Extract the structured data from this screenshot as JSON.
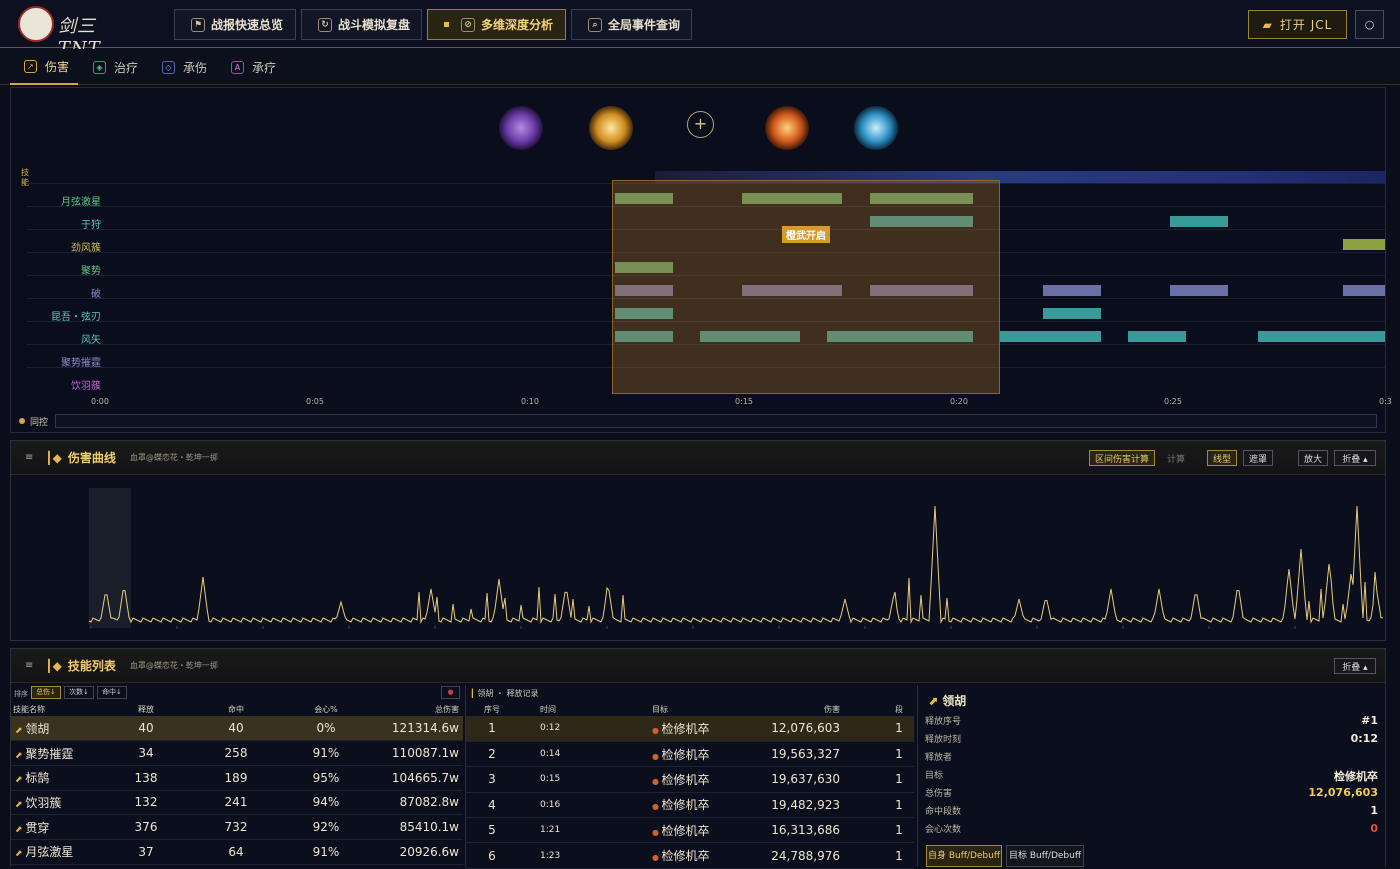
{
  "header": {
    "logo_text": "剑三TNT",
    "nav": [
      {
        "label": "战报快速总览",
        "icon": "flag-icon"
      },
      {
        "label": "战斗模拟复盘",
        "icon": "replay-icon"
      },
      {
        "label": "多维深度分析",
        "icon": "compass-icon",
        "active": true
      },
      {
        "label": "全局事件查询",
        "icon": "search-icon"
      }
    ],
    "open_jcl": "打开 JCL"
  },
  "tabs": [
    {
      "label": "伤害",
      "icon": "damage-icon",
      "active": true
    },
    {
      "label": "治疗",
      "icon": "heal-icon"
    },
    {
      "label": "承伤",
      "icon": "shield-icon"
    },
    {
      "label": "承疗",
      "icon": "receive-heal-icon"
    }
  ],
  "timeline": {
    "side_label": "技能",
    "skills": [
      "月弦激星",
      "于狩",
      "劲风簇",
      "聚势",
      "破",
      "昆吾・弦刃",
      "风矢",
      "聚势摧霆",
      "饮羽簇"
    ],
    "skill_colors": [
      "#5dcb87",
      "#59cfc2",
      "#d0c15a",
      "#5dcb87",
      "#8a8bd0",
      "#59cfc2",
      "#59cfc2",
      "#8a8bd0",
      "#c26ad8"
    ],
    "burst_label": "橙武开启",
    "x_ticks": [
      "0:00",
      "0:05",
      "0:10",
      "0:15",
      "0:20",
      "0:25",
      "0:3"
    ],
    "scrub_label": "同控"
  },
  "damage_curve": {
    "title": "伤害曲线",
    "subtitle": "血罩@蝶恋花・乾坤一掷",
    "buttons": [
      "区间伤害计算",
      "计算",
      "线型",
      "遮罩",
      "放大",
      "折叠 ▴"
    ]
  },
  "skill_list": {
    "title": "技能列表",
    "subtitle": "血罩@蝶恋花・乾坤一掷",
    "fold": "折叠 ▴",
    "sort_label": "排序",
    "sort_buttons": [
      "总伤↓",
      "次数↓",
      "命中↓"
    ],
    "columns": [
      "技能名称",
      "释放",
      "命中",
      "会心%",
      "总伤害"
    ],
    "rows": [
      {
        "name": "领胡",
        "cast": "40",
        "hit": "40",
        "crit": "0%",
        "total": "121314.6w"
      },
      {
        "name": "聚势摧霆",
        "cast": "34",
        "hit": "258",
        "crit": "91%",
        "total": "110087.1w"
      },
      {
        "name": "标鹄",
        "cast": "138",
        "hit": "189",
        "crit": "95%",
        "total": "104665.7w"
      },
      {
        "name": "饮羽簇",
        "cast": "132",
        "hit": "241",
        "crit": "94%",
        "total": "87082.8w"
      },
      {
        "name": "贯穿",
        "cast": "376",
        "hit": "732",
        "crit": "92%",
        "total": "85410.1w"
      },
      {
        "name": "月弦激星",
        "cast": "37",
        "hit": "64",
        "crit": "91%",
        "total": "20926.6w"
      }
    ]
  },
  "cast_record": {
    "title": "领胡 ・ 释放记录",
    "columns": [
      "序号",
      "时间",
      "目标",
      "伤害",
      "段"
    ],
    "rows": [
      {
        "idx": "1",
        "time": "0:12",
        "target": "检修机卒",
        "damage": "12,076,603",
        "seg": "1"
      },
      {
        "idx": "2",
        "time": "0:14",
        "target": "检修机卒",
        "damage": "19,563,327",
        "seg": "1"
      },
      {
        "idx": "3",
        "time": "0:15",
        "target": "检修机卒",
        "damage": "19,637,630",
        "seg": "1"
      },
      {
        "idx": "4",
        "time": "0:16",
        "target": "检修机卒",
        "damage": "19,482,923",
        "seg": "1"
      },
      {
        "idx": "5",
        "time": "1:21",
        "target": "检修机卒",
        "damage": "16,313,686",
        "seg": "1"
      },
      {
        "idx": "6",
        "time": "1:23",
        "target": "检修机卒",
        "damage": "24,788,976",
        "seg": "1"
      }
    ]
  },
  "detail": {
    "title": "领胡",
    "fields": [
      {
        "label": "释放序号",
        "value": "#1"
      },
      {
        "label": "释放时刻",
        "value": "0:12"
      },
      {
        "label": "释放者",
        "value": ""
      },
      {
        "label": "目标",
        "value": "检修机卒"
      },
      {
        "label": "总伤害",
        "value": "12,076,603"
      },
      {
        "label": "命中段数",
        "value": "1"
      },
      {
        "label": "会心次数",
        "value": "0"
      }
    ],
    "tabs": [
      "自身 Buff/Debuff",
      "目标 Buff/Debuff"
    ]
  },
  "colors": {
    "accent": "#d8a640",
    "highlight": "#f2cb58",
    "bg": "#0b0e1a"
  }
}
